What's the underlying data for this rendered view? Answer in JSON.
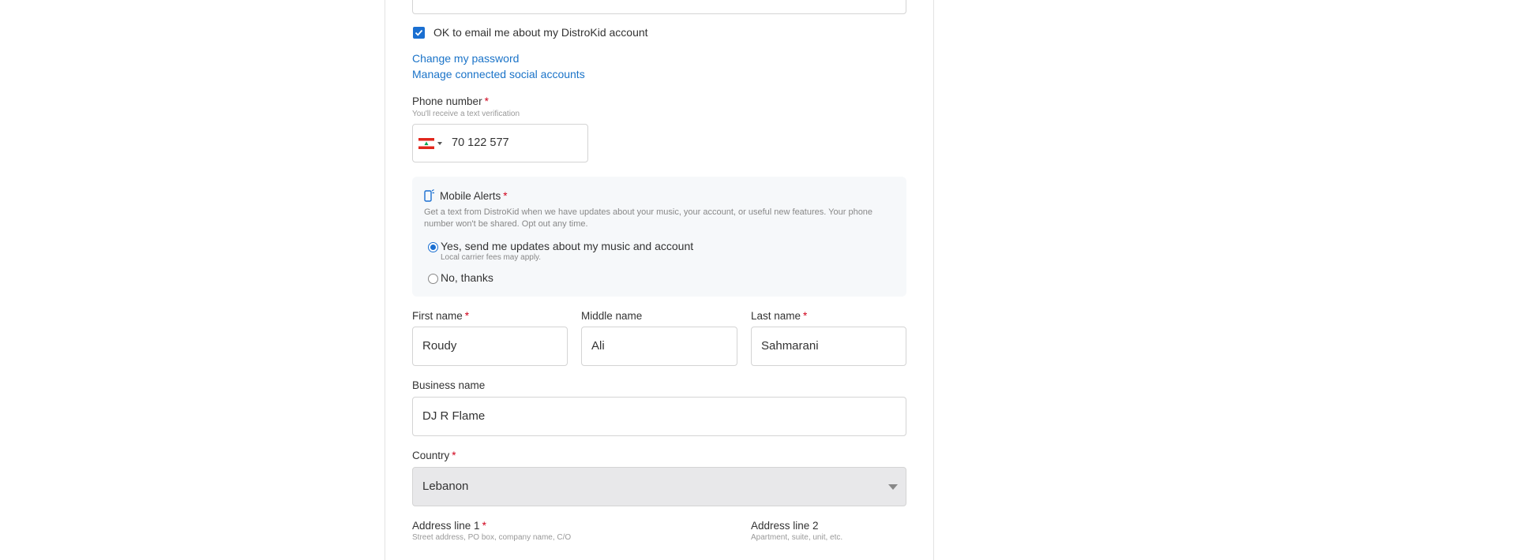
{
  "email": {
    "ok_to_email_label": "OK to email me about my DistroKid account",
    "checked": true
  },
  "links": {
    "change_password": "Change my password",
    "manage_social": "Manage connected social accounts"
  },
  "phone": {
    "label": "Phone number",
    "required": "*",
    "hint": "You'll receive a text verification",
    "country_flag": "lebanon-flag-icon",
    "value": "70 122 577"
  },
  "mobile_alerts": {
    "title": "Mobile Alerts",
    "required": "*",
    "description": "Get a text from DistroKid when we have updates about your music, your account, or useful new features. Your phone number won't be shared. Opt out any time.",
    "options": [
      {
        "label": "Yes, send me updates about my music and account",
        "sublabel": "Local carrier fees may apply.",
        "selected": true
      },
      {
        "label": "No, thanks",
        "selected": false
      }
    ]
  },
  "name": {
    "first_label": "First name",
    "first_value": "Roudy",
    "middle_label": "Middle name",
    "middle_value": "Ali",
    "last_label": "Last name",
    "last_value": "Sahmarani",
    "required": "*"
  },
  "business": {
    "label": "Business name",
    "value": "DJ R Flame"
  },
  "country": {
    "label": "Country",
    "required": "*",
    "value": "Lebanon"
  },
  "address": {
    "line1_label": "Address line 1",
    "line1_required": "*",
    "line1_hint": "Street address, PO box, company name, C/O",
    "line2_label": "Address line 2",
    "line2_hint": "Apartment, suite, unit, etc."
  },
  "colors": {
    "accent": "#1a6fd1",
    "link": "#1a73c8",
    "required": "#d0021b"
  }
}
